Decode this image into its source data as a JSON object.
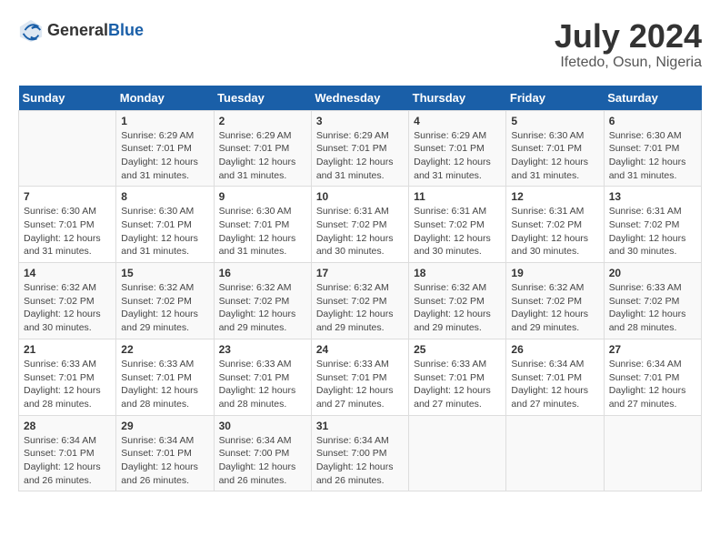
{
  "header": {
    "logo": {
      "text_general": "General",
      "text_blue": "Blue"
    },
    "title": "July 2024",
    "subtitle": "Ifetedo, Osun, Nigeria"
  },
  "calendar": {
    "days_of_week": [
      "Sunday",
      "Monday",
      "Tuesday",
      "Wednesday",
      "Thursday",
      "Friday",
      "Saturday"
    ],
    "weeks": [
      [
        {
          "day": "",
          "sunrise": "",
          "sunset": "",
          "daylight": ""
        },
        {
          "day": "1",
          "sunrise": "Sunrise: 6:29 AM",
          "sunset": "Sunset: 7:01 PM",
          "daylight": "Daylight: 12 hours and 31 minutes."
        },
        {
          "day": "2",
          "sunrise": "Sunrise: 6:29 AM",
          "sunset": "Sunset: 7:01 PM",
          "daylight": "Daylight: 12 hours and 31 minutes."
        },
        {
          "day": "3",
          "sunrise": "Sunrise: 6:29 AM",
          "sunset": "Sunset: 7:01 PM",
          "daylight": "Daylight: 12 hours and 31 minutes."
        },
        {
          "day": "4",
          "sunrise": "Sunrise: 6:29 AM",
          "sunset": "Sunset: 7:01 PM",
          "daylight": "Daylight: 12 hours and 31 minutes."
        },
        {
          "day": "5",
          "sunrise": "Sunrise: 6:30 AM",
          "sunset": "Sunset: 7:01 PM",
          "daylight": "Daylight: 12 hours and 31 minutes."
        },
        {
          "day": "6",
          "sunrise": "Sunrise: 6:30 AM",
          "sunset": "Sunset: 7:01 PM",
          "daylight": "Daylight: 12 hours and 31 minutes."
        }
      ],
      [
        {
          "day": "7",
          "sunrise": "Sunrise: 6:30 AM",
          "sunset": "Sunset: 7:01 PM",
          "daylight": "Daylight: 12 hours and 31 minutes."
        },
        {
          "day": "8",
          "sunrise": "Sunrise: 6:30 AM",
          "sunset": "Sunset: 7:01 PM",
          "daylight": "Daylight: 12 hours and 31 minutes."
        },
        {
          "day": "9",
          "sunrise": "Sunrise: 6:30 AM",
          "sunset": "Sunset: 7:01 PM",
          "daylight": "Daylight: 12 hours and 31 minutes."
        },
        {
          "day": "10",
          "sunrise": "Sunrise: 6:31 AM",
          "sunset": "Sunset: 7:02 PM",
          "daylight": "Daylight: 12 hours and 30 minutes."
        },
        {
          "day": "11",
          "sunrise": "Sunrise: 6:31 AM",
          "sunset": "Sunset: 7:02 PM",
          "daylight": "Daylight: 12 hours and 30 minutes."
        },
        {
          "day": "12",
          "sunrise": "Sunrise: 6:31 AM",
          "sunset": "Sunset: 7:02 PM",
          "daylight": "Daylight: 12 hours and 30 minutes."
        },
        {
          "day": "13",
          "sunrise": "Sunrise: 6:31 AM",
          "sunset": "Sunset: 7:02 PM",
          "daylight": "Daylight: 12 hours and 30 minutes."
        }
      ],
      [
        {
          "day": "14",
          "sunrise": "Sunrise: 6:32 AM",
          "sunset": "Sunset: 7:02 PM",
          "daylight": "Daylight: 12 hours and 30 minutes."
        },
        {
          "day": "15",
          "sunrise": "Sunrise: 6:32 AM",
          "sunset": "Sunset: 7:02 PM",
          "daylight": "Daylight: 12 hours and 29 minutes."
        },
        {
          "day": "16",
          "sunrise": "Sunrise: 6:32 AM",
          "sunset": "Sunset: 7:02 PM",
          "daylight": "Daylight: 12 hours and 29 minutes."
        },
        {
          "day": "17",
          "sunrise": "Sunrise: 6:32 AM",
          "sunset": "Sunset: 7:02 PM",
          "daylight": "Daylight: 12 hours and 29 minutes."
        },
        {
          "day": "18",
          "sunrise": "Sunrise: 6:32 AM",
          "sunset": "Sunset: 7:02 PM",
          "daylight": "Daylight: 12 hours and 29 minutes."
        },
        {
          "day": "19",
          "sunrise": "Sunrise: 6:32 AM",
          "sunset": "Sunset: 7:02 PM",
          "daylight": "Daylight: 12 hours and 29 minutes."
        },
        {
          "day": "20",
          "sunrise": "Sunrise: 6:33 AM",
          "sunset": "Sunset: 7:02 PM",
          "daylight": "Daylight: 12 hours and 28 minutes."
        }
      ],
      [
        {
          "day": "21",
          "sunrise": "Sunrise: 6:33 AM",
          "sunset": "Sunset: 7:01 PM",
          "daylight": "Daylight: 12 hours and 28 minutes."
        },
        {
          "day": "22",
          "sunrise": "Sunrise: 6:33 AM",
          "sunset": "Sunset: 7:01 PM",
          "daylight": "Daylight: 12 hours and 28 minutes."
        },
        {
          "day": "23",
          "sunrise": "Sunrise: 6:33 AM",
          "sunset": "Sunset: 7:01 PM",
          "daylight": "Daylight: 12 hours and 28 minutes."
        },
        {
          "day": "24",
          "sunrise": "Sunrise: 6:33 AM",
          "sunset": "Sunset: 7:01 PM",
          "daylight": "Daylight: 12 hours and 27 minutes."
        },
        {
          "day": "25",
          "sunrise": "Sunrise: 6:33 AM",
          "sunset": "Sunset: 7:01 PM",
          "daylight": "Daylight: 12 hours and 27 minutes."
        },
        {
          "day": "26",
          "sunrise": "Sunrise: 6:34 AM",
          "sunset": "Sunset: 7:01 PM",
          "daylight": "Daylight: 12 hours and 27 minutes."
        },
        {
          "day": "27",
          "sunrise": "Sunrise: 6:34 AM",
          "sunset": "Sunset: 7:01 PM",
          "daylight": "Daylight: 12 hours and 27 minutes."
        }
      ],
      [
        {
          "day": "28",
          "sunrise": "Sunrise: 6:34 AM",
          "sunset": "Sunset: 7:01 PM",
          "daylight": "Daylight: 12 hours and 26 minutes."
        },
        {
          "day": "29",
          "sunrise": "Sunrise: 6:34 AM",
          "sunset": "Sunset: 7:01 PM",
          "daylight": "Daylight: 12 hours and 26 minutes."
        },
        {
          "day": "30",
          "sunrise": "Sunrise: 6:34 AM",
          "sunset": "Sunset: 7:00 PM",
          "daylight": "Daylight: 12 hours and 26 minutes."
        },
        {
          "day": "31",
          "sunrise": "Sunrise: 6:34 AM",
          "sunset": "Sunset: 7:00 PM",
          "daylight": "Daylight: 12 hours and 26 minutes."
        },
        {
          "day": "",
          "sunrise": "",
          "sunset": "",
          "daylight": ""
        },
        {
          "day": "",
          "sunrise": "",
          "sunset": "",
          "daylight": ""
        },
        {
          "day": "",
          "sunrise": "",
          "sunset": "",
          "daylight": ""
        }
      ]
    ]
  }
}
